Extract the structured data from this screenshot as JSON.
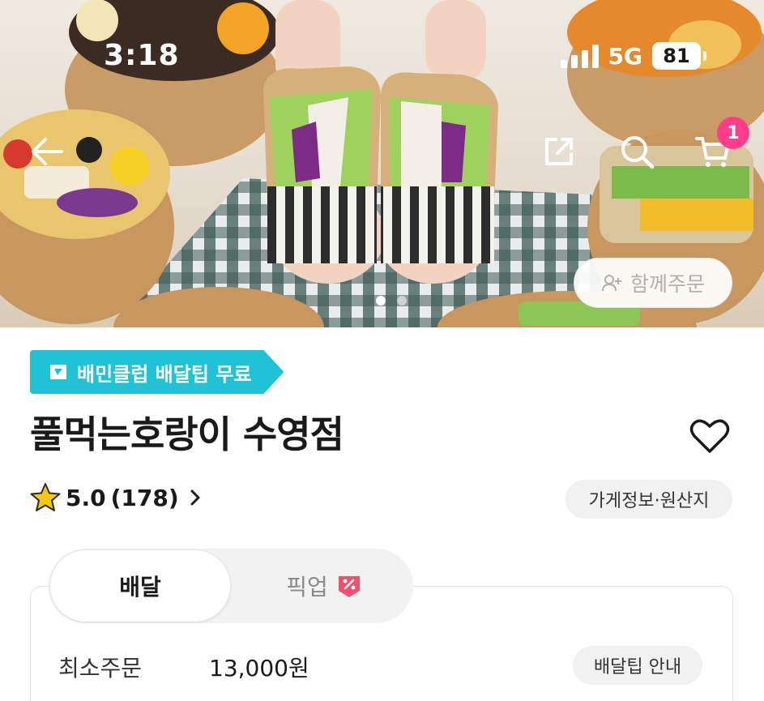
{
  "status_bar": {
    "time": "3:18",
    "network": "5G",
    "battery": "81"
  },
  "hero": {
    "cart_count": "1",
    "group_order_label": "함께주문",
    "carousel": {
      "total": 2,
      "active": 1
    }
  },
  "store": {
    "club_badge": "배민클럽 배달팁 무료",
    "name": "풀먹는호랑이 수영점",
    "rating": "5.0",
    "review_count": "(178)",
    "info_chip": "가게정보·원산지"
  },
  "tabs": {
    "delivery": "배달",
    "pickup": "픽업"
  },
  "delivery_info": {
    "min_order_label": "최소주문",
    "min_order_value": "13,000원",
    "tip_info_button": "배달팁 안내"
  },
  "colors": {
    "club_badge": "#21c1d6",
    "cart_badge": "#ff3d8b",
    "pickup_discount": "#f0506e",
    "star": "#f5c518"
  },
  "icons": [
    "back-arrow-icon",
    "share-icon",
    "search-icon",
    "cart-icon",
    "add-person-icon",
    "baemin-club-icon",
    "heart-icon",
    "star-icon",
    "chevron-right-icon",
    "discount-tag-icon"
  ]
}
